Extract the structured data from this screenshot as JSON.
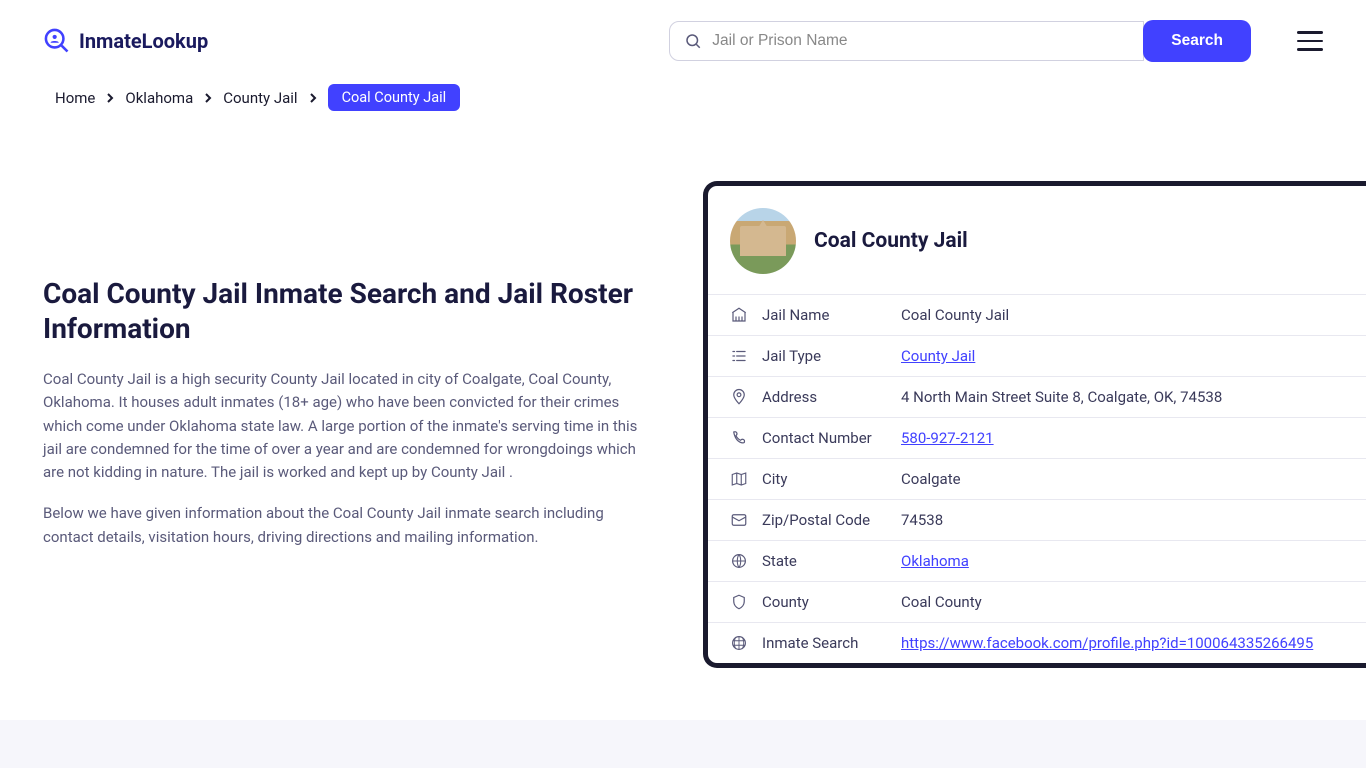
{
  "header": {
    "logo_text": "InmateLookup",
    "search_placeholder": "Jail or Prison Name",
    "search_button": "Search"
  },
  "breadcrumb": {
    "items": [
      "Home",
      "Oklahoma",
      "County Jail"
    ],
    "current": "Coal County Jail"
  },
  "main": {
    "title": "Coal County Jail Inmate Search and Jail Roster Information",
    "p1": "Coal County Jail is a high security County Jail located in city of Coalgate, Coal County, Oklahoma. It houses adult inmates (18+ age) who have been convicted for their crimes which come under Oklahoma state law. A large portion of the inmate's serving time in this jail are condemned for the time of over a year and are condemned for wrongdoings which are not kidding in nature. The jail is worked and kept up by County Jail .",
    "p2": "Below we have given information about the Coal County Jail inmate search including contact details, visitation hours, driving directions and mailing information."
  },
  "card": {
    "title": "Coal County Jail",
    "rows": [
      {
        "icon": "building",
        "label": "Jail Name",
        "value": "Coal County Jail",
        "link": false
      },
      {
        "icon": "list",
        "label": "Jail Type",
        "value": "County Jail",
        "link": true
      },
      {
        "icon": "pin",
        "label": "Address",
        "value": "4 North Main Street Suite 8, Coalgate, OK, 74538",
        "link": false
      },
      {
        "icon": "phone",
        "label": "Contact Number",
        "value": "580-927-2121",
        "link": true
      },
      {
        "icon": "map",
        "label": "City",
        "value": "Coalgate",
        "link": false
      },
      {
        "icon": "mail",
        "label": "Zip/Postal Code",
        "value": "74538",
        "link": false
      },
      {
        "icon": "globe",
        "label": "State",
        "value": "Oklahoma",
        "link": true
      },
      {
        "icon": "shield",
        "label": "County",
        "value": "Coal County",
        "link": false
      },
      {
        "icon": "world",
        "label": "Inmate Search",
        "value": "https://www.facebook.com/profile.php?id=100064335266495",
        "link": true
      }
    ]
  }
}
